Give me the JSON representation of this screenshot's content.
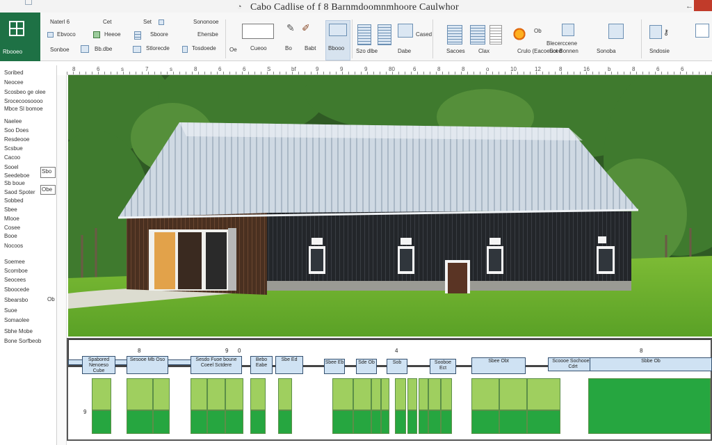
{
  "window": {
    "title": "Cabo Cadlise of f 8 Barnmdoomnmhoore Caulwhor",
    "back_glyph": "←"
  },
  "app": {
    "label": "Rbooeo"
  },
  "ribbon": {
    "col1": [
      "Naterl 6",
      "Ebvoco",
      "Sonboe"
    ],
    "col2": [
      "Cet",
      "Heeoe",
      "Bb.dbe"
    ],
    "col3": [
      "Set",
      "Sboore",
      "Stlorecde"
    ],
    "col4": [
      "Sononooe",
      "Ehersbe",
      "Tosdoede"
    ],
    "group_labels": [
      "Oe",
      "Cueoo",
      "Bo",
      "Babt",
      "Bbooo",
      "Szo dlbe",
      "Cased",
      "Dabe",
      "Sacoes",
      "Clax",
      "Crulo (Eacoeuced",
      "Blecerccene",
      "Sot Bonnen",
      "Sonoba",
      "Sndosie"
    ],
    "small_label": "Ob"
  },
  "ruler": {
    "ticks": [
      "8",
      "6",
      "s",
      "7",
      "s",
      "8",
      "6",
      "6",
      "S",
      "bf",
      "9",
      "9",
      "9",
      "80",
      "6",
      "8",
      "8",
      "o",
      "10",
      "12",
      "8",
      "16",
      "b",
      "8",
      "6",
      "6"
    ]
  },
  "left_panel": {
    "items": [
      "Soribed",
      "Neocee",
      "Scosbeo ge olee",
      "Srocecoosoooo",
      "Mbce Sl bomoe",
      "Naelee",
      "Soo Does",
      "Resdeooe",
      "Scsbue",
      "Cacoo",
      "Sooel",
      "Seedeboe",
      "Sb boue",
      "Saod Spoter",
      "Sobbed",
      "Sbee",
      "Mlooe",
      "Cosee",
      "Booe",
      "Nocoos",
      "Soemee",
      "Scomboe",
      "Seocees",
      "Sboocede",
      "Sbearsbo",
      "Suoe",
      "Somaolee",
      "Sbhe Mobe",
      "Bone Sorfbeob"
    ],
    "box1": "Sbo",
    "box2": "Obe",
    "box3": "Ob"
  },
  "table": {
    "top_numbers": [
      "8",
      "9",
      "0",
      "4",
      "8"
    ],
    "side_number": "9",
    "headers": [
      "Spabored Nenoeso Cube",
      "Sesooe Mb Oso",
      "Sesdo Fuoe boune Coeel Sctdere",
      "Bebo Eabe",
      "Sbe Ed",
      "Sbee Eb",
      "Sde Ob",
      "Sob",
      "Sooboe Ect",
      "Sbee Obt",
      "Scoooe Sochooere Cdrt",
      "Sbbe Ob"
    ]
  },
  "colors": {
    "app_green": "#1e7145",
    "header_blue": "#cfe2f3",
    "light_green": "#9fcf5f",
    "dark_green": "#26a640",
    "close_red": "#c13b2a"
  }
}
